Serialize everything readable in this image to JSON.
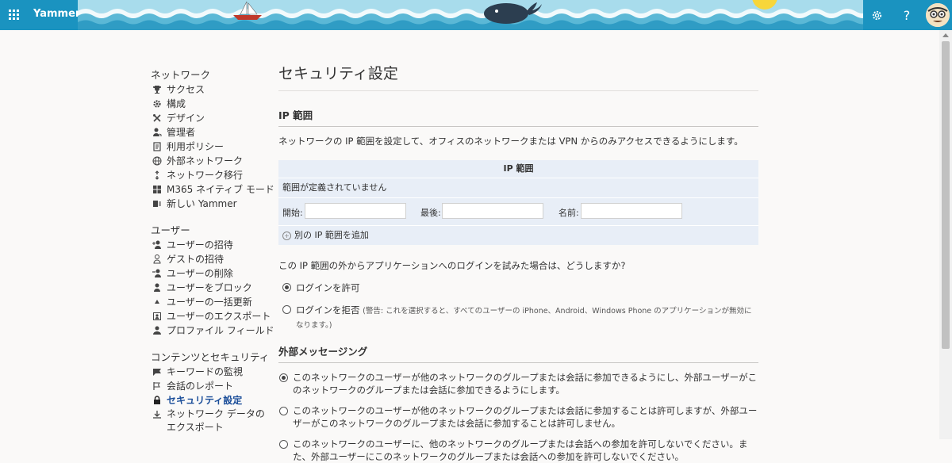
{
  "app": {
    "name": "Yammer"
  },
  "header": {
    "icons": {
      "waffle": "waffle-icon",
      "settings": "gear-icon",
      "help": "help-icon"
    },
    "help_label": "?"
  },
  "sidebar": {
    "sections": [
      {
        "title": "ネットワーク",
        "items": [
          {
            "label": "サクセス",
            "icon": "trophy-icon"
          },
          {
            "label": "構成",
            "icon": "gear-icon"
          },
          {
            "label": "デザイン",
            "icon": "tools-icon"
          },
          {
            "label": "管理者",
            "icon": "admin-icon"
          },
          {
            "label": "利用ポリシー",
            "icon": "document-icon"
          },
          {
            "label": "外部ネットワーク",
            "icon": "globe-icon"
          },
          {
            "label": "ネットワーク移行",
            "icon": "migrate-icon"
          },
          {
            "label": "M365 ネイティブ モード",
            "icon": "grid-icon"
          },
          {
            "label": "新しい Yammer",
            "icon": "yammer-icon"
          }
        ]
      },
      {
        "title": "ユーザー",
        "items": [
          {
            "label": "ユーザーの招待",
            "icon": "add-user-icon"
          },
          {
            "label": "ゲストの招待",
            "icon": "guest-icon"
          },
          {
            "label": "ユーザーの削除",
            "icon": "remove-user-icon"
          },
          {
            "label": "ユーザーをブロック",
            "icon": "block-user-icon"
          },
          {
            "label": "ユーザーの一括更新",
            "icon": "bulk-update-icon"
          },
          {
            "label": "ユーザーのエクスポート",
            "icon": "export-user-icon"
          },
          {
            "label": "プロファイル フィールド",
            "icon": "profile-icon"
          }
        ]
      },
      {
        "title": "コンテンツとセキュリティ",
        "items": [
          {
            "label": "キーワードの監視",
            "icon": "flag-icon"
          },
          {
            "label": "会話のレポート",
            "icon": "report-flag-icon"
          },
          {
            "label": "セキュリティ設定",
            "icon": "lock-icon",
            "active": true
          },
          {
            "label": "ネットワーク データのエクスポート",
            "icon": "download-icon"
          }
        ]
      }
    ]
  },
  "main": {
    "title": "セキュリティ設定",
    "ip_section": {
      "heading": "IP 範囲",
      "description": "ネットワークの IP 範囲を設定して、オフィスのネットワークまたは VPN からのみアクセスできるようにします。",
      "table_header": "IP 範囲",
      "empty_text": "範囲が定義されていません",
      "start_label": "開始:",
      "end_label": "最後:",
      "name_label": "名前:",
      "start_value": "",
      "end_value": "",
      "name_value": "",
      "add_link": "別の IP 範囲を追加",
      "question": "この IP 範囲の外からアプリケーションへのログインを試みた場合は、どうしますか?",
      "allow_label": "ログインを許可",
      "deny_label": "ログインを拒否",
      "deny_warning": "(警告: これを選択すると、すべてのユーザーの iPhone、Android、Windows Phone のアプリケーションが無効になります。)"
    },
    "external_section": {
      "heading": "外部メッセージング",
      "options": [
        {
          "label": "このネットワークのユーザーが他のネットワークのグループまたは会話に参加できるようにし、外部ユーザーがこのネットワークのグループまたは会話に参加できるようにします。",
          "selected": true
        },
        {
          "label": "このネットワークのユーザーが他のネットワークのグループまたは会話に参加することは許可しますが、外部ユーザーがこのネットワークのグループまたは会話に参加することは許可しません。",
          "selected": false
        },
        {
          "label": "このネットワークのユーザーに、他のネットワークのグループまたは会話への参加を許可しないでください。また、外部ユーザーにこのネットワークのグループまたは会話への参加を許可しないでください。",
          "selected": false
        }
      ]
    }
  }
}
